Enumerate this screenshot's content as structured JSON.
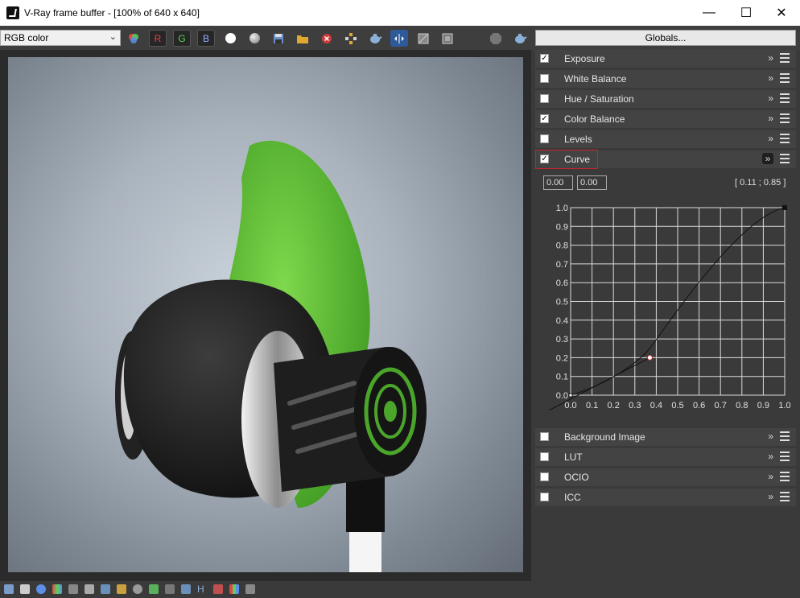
{
  "window": {
    "title": "V-Ray frame buffer - [100% of 640 x 640]",
    "minimize": "—",
    "maximize": "☐",
    "close": "✕"
  },
  "toolbar": {
    "channel_select": "RGB color",
    "channel_options_icon": "chevron-down-icon",
    "r_label": "R",
    "g_label": "G",
    "b_label": "B",
    "globals_label": "Globals..."
  },
  "colors": {
    "red_channel": "#e04646",
    "green_channel": "#5ad25a",
    "blue_channel": "#5a8ee8",
    "curve_highlight": "#c8242c",
    "earbud_green": "#5fbf3a"
  },
  "panel": {
    "sections_top": [
      {
        "label": "Exposure",
        "checked": true
      },
      {
        "label": "White Balance",
        "checked": false
      },
      {
        "label": "Hue / Saturation",
        "checked": false
      },
      {
        "label": "Color Balance",
        "checked": true
      },
      {
        "label": "Levels",
        "checked": false
      }
    ],
    "curve": {
      "label": "Curve",
      "checked": true,
      "input_x": "0.00",
      "input_y": "0.00",
      "cursor_readout": "[ 0.11 ; 0.85 ]",
      "x_ticks": [
        "0.0",
        "0.1",
        "0.2",
        "0.3",
        "0.4",
        "0.5",
        "0.6",
        "0.7",
        "0.8",
        "0.9",
        "1.0"
      ],
      "y_ticks": [
        "0.0",
        "0.1",
        "0.2",
        "0.3",
        "0.4",
        "0.5",
        "0.6",
        "0.7",
        "0.8",
        "0.9",
        "1.0"
      ],
      "control_points": [
        [
          0.0,
          0.0
        ],
        [
          0.37,
          0.2
        ],
        [
          1.0,
          1.0
        ]
      ]
    },
    "sections_bottom": [
      {
        "label": "Background Image",
        "checked": false
      },
      {
        "label": "LUT",
        "checked": false
      },
      {
        "label": "OCIO",
        "checked": false
      },
      {
        "label": "ICC",
        "checked": false
      }
    ]
  }
}
